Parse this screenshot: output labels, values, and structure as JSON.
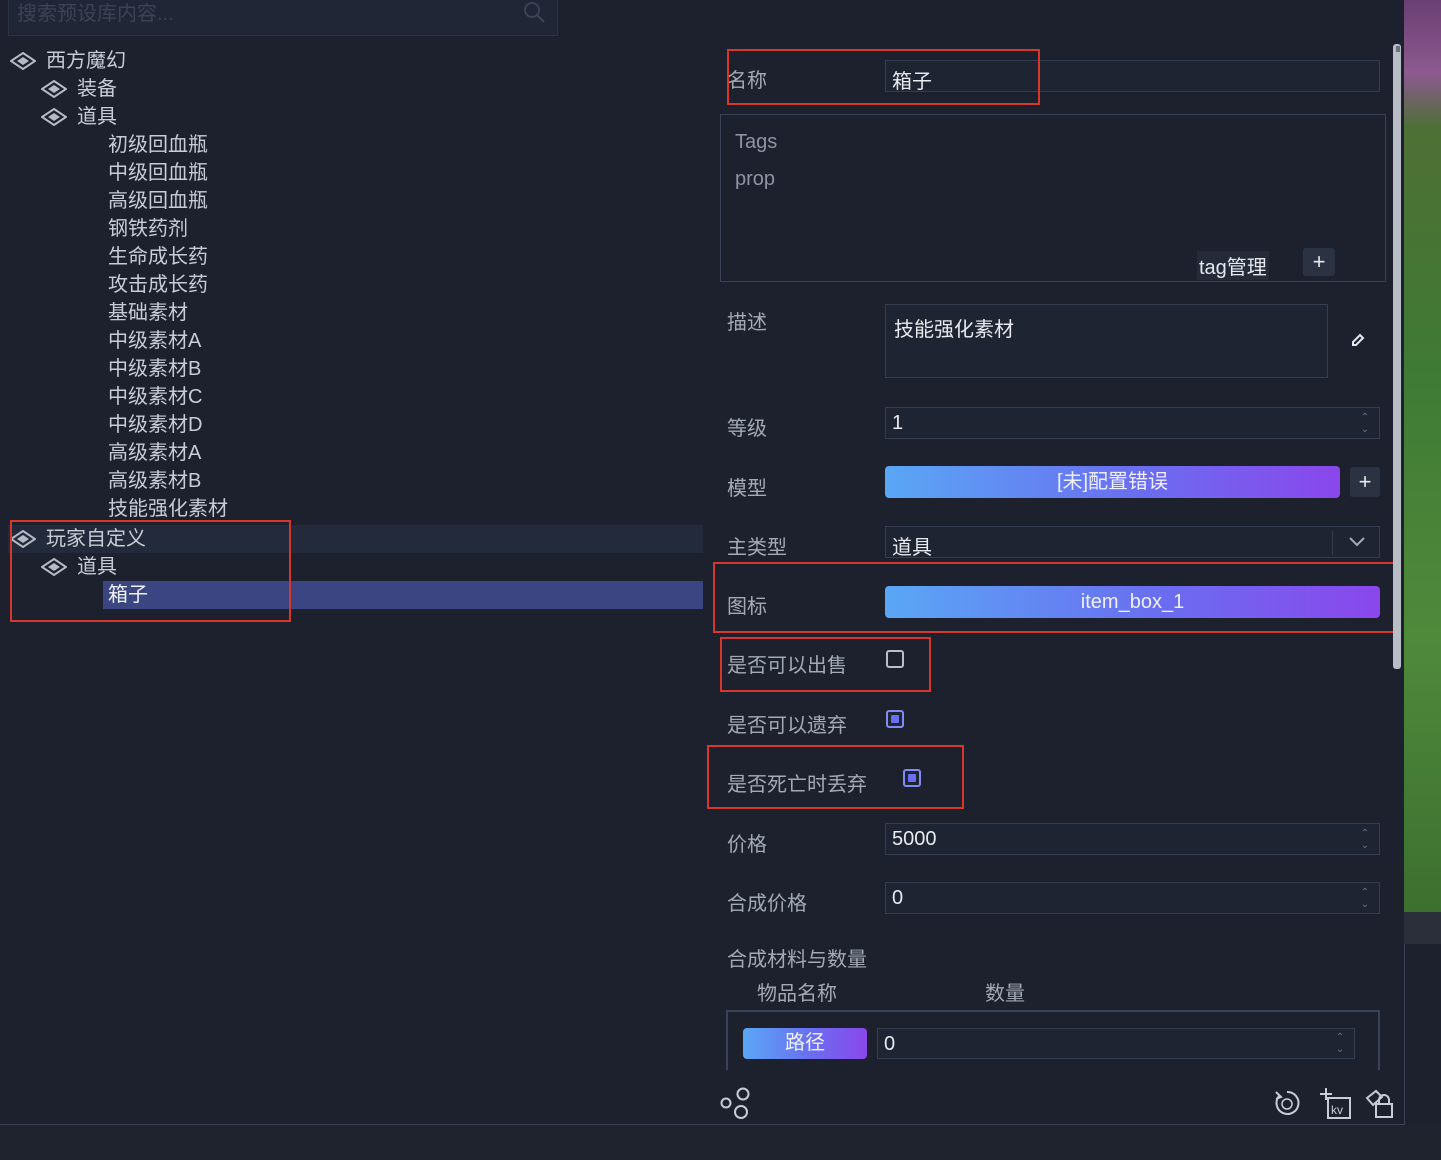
{
  "search": {
    "placeholder": "搜索预设库内容..."
  },
  "tree": {
    "groups": [
      {
        "label": "西方魔幻"
      },
      {
        "label": "装备"
      },
      {
        "label": "道具"
      }
    ],
    "items": [
      "初级回血瓶",
      "中级回血瓶",
      "高级回血瓶",
      "钢铁药剂",
      "生命成长药",
      "攻击成长药",
      "基础素材",
      "中级素材A",
      "中级素材B",
      "中级素材C",
      "中级素材D",
      "高级素材A",
      "高级素材B",
      "技能强化素材"
    ],
    "custom_group": "玩家自定义",
    "custom_sub": "道具",
    "custom_item": "箱子"
  },
  "form": {
    "name_label": "名称",
    "name_value": "箱子",
    "tags_title": "Tags",
    "tag_value": "prop",
    "tag_manage": "tag管理",
    "tag_add": "+",
    "desc_label": "描述",
    "desc_value": "技能强化素材",
    "level_label": "等级",
    "level_value": "1",
    "model_label": "模型",
    "model_value": "[未]配置错误",
    "model_add": "+",
    "type_label": "主类型",
    "type_value": "道具",
    "icon_label": "图标",
    "icon_value": "item_box_1",
    "sellable_label": "是否可以出售",
    "sellable": false,
    "discardable_label": "是否可以遗弃",
    "discardable": true,
    "drop_on_death_label": "是否死亡时丢弃",
    "drop_on_death": true,
    "price_label": "价格",
    "price_value": "5000",
    "craft_price_label": "合成价格",
    "craft_price_value": "0",
    "materials_label": "合成材料与数量",
    "col_item_name": "物品名称",
    "col_quantity": "数量",
    "path_button": "路径",
    "material_qty": "0"
  },
  "colors": {
    "accent_start": "#5aa7f5",
    "accent_end": "#8a47ec",
    "selection": "#3b4581",
    "highlight_box": "#d6362c"
  }
}
